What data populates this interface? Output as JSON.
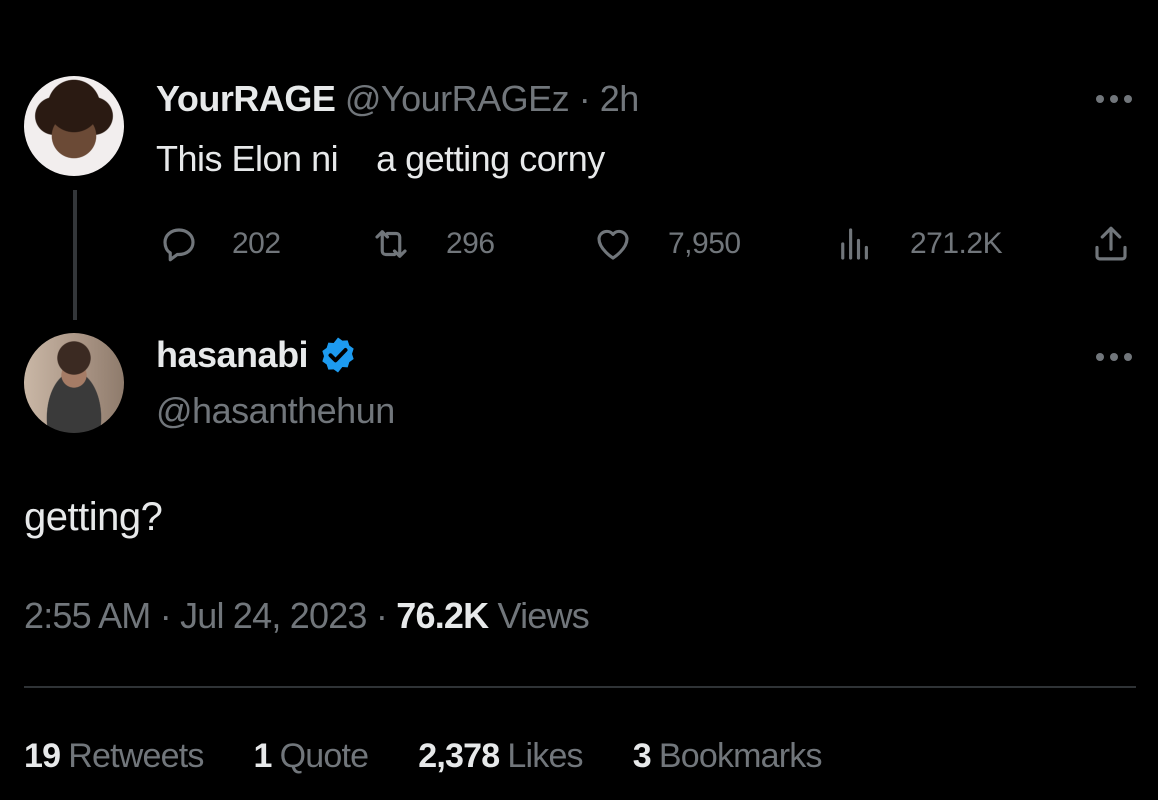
{
  "reply_to": {
    "display_name": "YourRAGE",
    "handle": "@YourRAGEz",
    "separator": "·",
    "time_ago": "2h",
    "text": "This Elon ni    a getting corny",
    "actions": {
      "replies": "202",
      "retweets": "296",
      "likes": "7,950",
      "views": "271.2K"
    },
    "icons": [
      "reply-icon",
      "retweet-icon",
      "like-icon",
      "views-icon",
      "share-icon",
      "more-icon"
    ]
  },
  "main_tweet": {
    "display_name": "hasanabi",
    "verified": true,
    "verified_color": "#1d9bf0",
    "handle": "@hasanthehun",
    "text": "getting?",
    "time": "2:55 AM",
    "date": "Jul 24, 2023",
    "separator": "·",
    "views_count": "76.2K",
    "views_label": "Views",
    "stats": [
      {
        "count": "19",
        "label": "Retweets"
      },
      {
        "count": "1",
        "label": "Quote"
      },
      {
        "count": "2,378",
        "label": "Likes"
      },
      {
        "count": "3",
        "label": "Bookmarks"
      }
    ]
  },
  "colors": {
    "background": "#000000",
    "primary_text": "#e7e9ea",
    "secondary_text": "#71767b",
    "divider": "#2f3336"
  }
}
